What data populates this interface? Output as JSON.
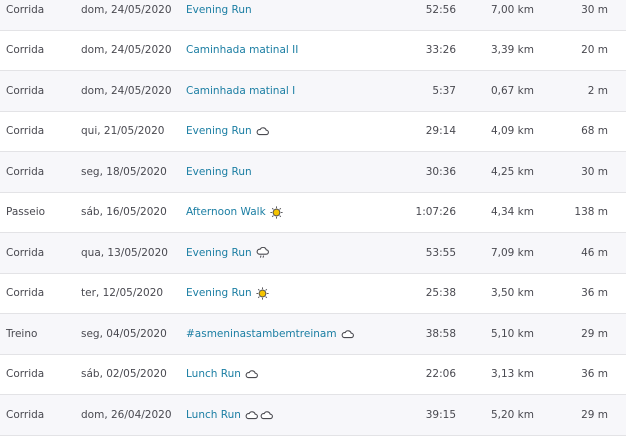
{
  "activities": [
    {
      "sport": "Corrida",
      "date": "dom, 24/05/2020",
      "title": "Evening Run",
      "weather": [],
      "time": "52:56",
      "distance": "7,00 km",
      "elevation": "30 m"
    },
    {
      "sport": "Corrida",
      "date": "dom, 24/05/2020",
      "title": "Caminhada matinal II",
      "weather": [],
      "time": "33:26",
      "distance": "3,39 km",
      "elevation": "20 m"
    },
    {
      "sport": "Corrida",
      "date": "dom, 24/05/2020",
      "title": "Caminhada matinal I",
      "weather": [],
      "time": "5:37",
      "distance": "0,67 km",
      "elevation": "2 m"
    },
    {
      "sport": "Corrida",
      "date": "qui, 21/05/2020",
      "title": "Evening Run",
      "weather": [
        "cloud-icon"
      ],
      "time": "29:14",
      "distance": "4,09 km",
      "elevation": "68 m"
    },
    {
      "sport": "Corrida",
      "date": "seg, 18/05/2020",
      "title": "Evening Run",
      "weather": [],
      "time": "30:36",
      "distance": "4,25 km",
      "elevation": "30 m"
    },
    {
      "sport": "Passeio",
      "date": "sáb, 16/05/2020",
      "title": "Afternoon Walk",
      "weather": [
        "sun-icon"
      ],
      "time": "1:07:26",
      "distance": "4,34 km",
      "elevation": "138 m"
    },
    {
      "sport": "Corrida",
      "date": "qua, 13/05/2020",
      "title": "Evening Run",
      "weather": [
        "rain-cloud-icon"
      ],
      "time": "53:55",
      "distance": "7,09 km",
      "elevation": "46 m"
    },
    {
      "sport": "Corrida",
      "date": "ter, 12/05/2020",
      "title": "Evening Run",
      "weather": [
        "sun-icon"
      ],
      "time": "25:38",
      "distance": "3,50 km",
      "elevation": "36 m"
    },
    {
      "sport": "Treino",
      "date": "seg, 04/05/2020",
      "title": "#asmeninastambemtreinam",
      "weather": [
        "cloud-icon"
      ],
      "time": "38:58",
      "distance": "5,10 km",
      "elevation": "29 m"
    },
    {
      "sport": "Corrida",
      "date": "sáb, 02/05/2020",
      "title": "Lunch Run",
      "weather": [
        "cloud-icon"
      ],
      "time": "22:06",
      "distance": "3,13 km",
      "elevation": "36 m"
    },
    {
      "sport": "Corrida",
      "date": "dom, 26/04/2020",
      "title": "Lunch Run",
      "weather": [
        "cloud-icon",
        "cloud-icon"
      ],
      "time": "39:15",
      "distance": "5,20 km",
      "elevation": "29 m"
    }
  ],
  "colors": {
    "link": "#1b7ea3",
    "sun": "#f5c400",
    "cloud_stroke": "#4a4a50"
  }
}
